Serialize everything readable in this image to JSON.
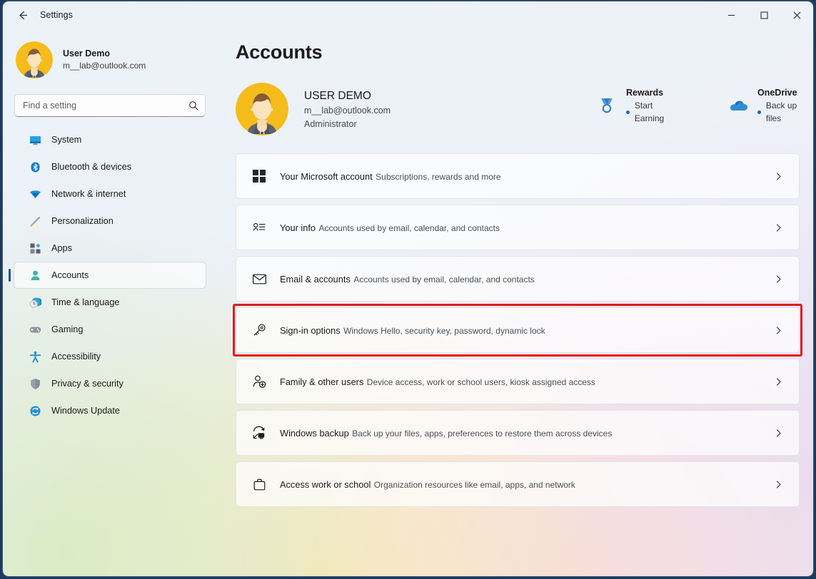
{
  "window": {
    "back_label": "back-arrow",
    "title": "Settings",
    "controls": {
      "minimize": "─",
      "maximize": "□",
      "close": "✕"
    }
  },
  "sidebar": {
    "profile": {
      "name": "User Demo",
      "email": "m__lab@outlook.com",
      "avatar": "user-avatar"
    },
    "search": {
      "placeholder": "Find a setting",
      "value": "",
      "icon": "search-icon"
    },
    "items": [
      {
        "label": "System",
        "icon": "monitor-icon",
        "selected": false
      },
      {
        "label": "Bluetooth & devices",
        "icon": "bluetooth-icon",
        "selected": false
      },
      {
        "label": "Network & internet",
        "icon": "wifi-icon",
        "selected": false
      },
      {
        "label": "Personalization",
        "icon": "paintbrush-icon",
        "selected": false
      },
      {
        "label": "Apps",
        "icon": "apps-icon",
        "selected": false
      },
      {
        "label": "Accounts",
        "icon": "person-icon",
        "selected": true
      },
      {
        "label": "Time & language",
        "icon": "clock-globe-icon",
        "selected": false
      },
      {
        "label": "Gaming",
        "icon": "gamepad-icon",
        "selected": false
      },
      {
        "label": "Accessibility",
        "icon": "accessibility-icon",
        "selected": false
      },
      {
        "label": "Privacy & security",
        "icon": "shield-icon",
        "selected": false
      },
      {
        "label": "Windows Update",
        "icon": "update-icon",
        "selected": false
      }
    ]
  },
  "main": {
    "page_title": "Accounts",
    "account": {
      "name": "USER DEMO",
      "email": "m__lab@outlook.com",
      "role": "Administrator",
      "avatar": "user-avatar"
    },
    "widgets": [
      {
        "title": "Rewards",
        "subtitle": "Start Earning",
        "icon": "medal-icon"
      },
      {
        "title": "OneDrive",
        "subtitle": "Back up files",
        "icon": "cloud-icon"
      }
    ],
    "cards": [
      {
        "title": "Your Microsoft account",
        "subtitle": "Subscriptions, rewards and more",
        "icon": "windows-logo-icon",
        "highlighted": false
      },
      {
        "title": "Your info",
        "subtitle": "Accounts used by email, calendar, and contacts",
        "icon": "contact-card-icon",
        "highlighted": false
      },
      {
        "title": "Email & accounts",
        "subtitle": "Accounts used by email, calendar, and contacts",
        "icon": "envelope-icon",
        "highlighted": false
      },
      {
        "title": "Sign-in options",
        "subtitle": "Windows Hello, security key, password, dynamic lock",
        "icon": "key-icon",
        "highlighted": true
      },
      {
        "title": "Family & other users",
        "subtitle": "Device access, work or school users, kiosk assigned access",
        "icon": "person-add-icon",
        "highlighted": false
      },
      {
        "title": "Windows backup",
        "subtitle": "Back up your files, apps, preferences to restore them across devices",
        "icon": "backup-icon",
        "highlighted": false
      },
      {
        "title": "Access work or school",
        "subtitle": "Organization resources like email, apps, and network",
        "icon": "briefcase-icon",
        "highlighted": false
      }
    ],
    "chevron": "chevron-right-icon"
  },
  "colors": {
    "accent": "#0f56a0",
    "highlight": "#e21b1b",
    "avatar_bg": "#f5bc1b",
    "bullet": "#0f6cbd"
  }
}
